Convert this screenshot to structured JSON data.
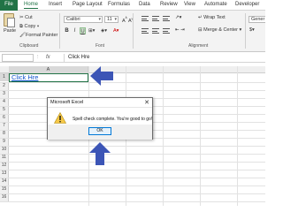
{
  "ribbon_tabs": [
    "File",
    "Home",
    "Insert",
    "Page Layout",
    "Formulas",
    "Data",
    "Review",
    "View",
    "Automate",
    "Developer"
  ],
  "clipboard": {
    "paste": "Paste",
    "cut": "Cut",
    "copy": "Copy",
    "format_painter": "Format Painter",
    "group": "Clipboard"
  },
  "font": {
    "name": "Calibri",
    "size": "11",
    "bold": "B",
    "italic": "I",
    "underline": "U",
    "group": "Font"
  },
  "alignment": {
    "wrap_text": "Wrap Text",
    "merge_center": "Merge & Center",
    "group": "Alignment"
  },
  "number": {
    "format": "Gener"
  },
  "formula_bar": {
    "fx": "fx",
    "value": "Click Hre"
  },
  "grid": {
    "column_a": "A",
    "rows": [
      "1",
      "2",
      "3",
      "4",
      "5",
      "6",
      "7",
      "8",
      "9",
      "10",
      "11",
      "12",
      "13",
      "14",
      "15",
      "16"
    ],
    "cell_a1": "Click Hre"
  },
  "dialog": {
    "title": "Microsoft Excel",
    "close": "✕",
    "message": "Spell check complete. You're good to go!",
    "ok": "OK"
  },
  "colors": {
    "excel_green": "#217346",
    "arrow_blue": "#3c55b6",
    "hyperlink": "#1155cc"
  }
}
